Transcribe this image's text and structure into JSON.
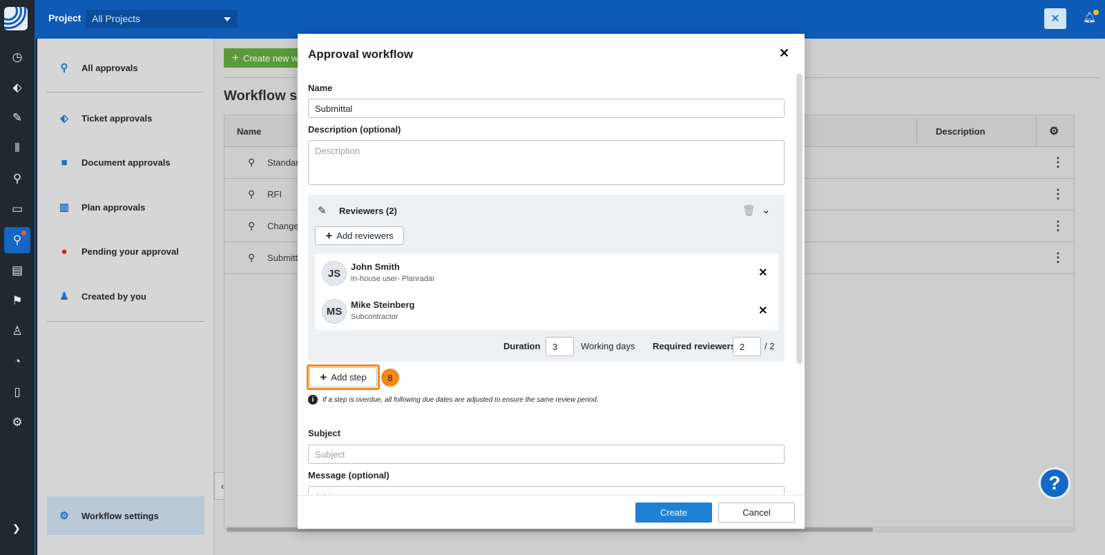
{
  "topbar": {
    "project_label": "Project",
    "project_select_value": "All Projects"
  },
  "sidebar": {
    "items": [
      {
        "label": "All approvals",
        "icon": "stamp-icon"
      },
      {
        "label": "Ticket approvals",
        "icon": "tag-icon"
      },
      {
        "label": "Document approvals",
        "icon": "folder-icon"
      },
      {
        "label": "Plan approvals",
        "icon": "map-icon"
      },
      {
        "label": "Pending your approval",
        "icon": "clock-icon"
      },
      {
        "label": "Created by you",
        "icon": "person-icon"
      }
    ],
    "settings_label": "Workflow settings"
  },
  "main": {
    "create_button": "Create new w",
    "title": "Workflow se",
    "table": {
      "col_name": "Name",
      "col_description": "Description",
      "rows": [
        {
          "name": "Standar"
        },
        {
          "name": "RFI"
        },
        {
          "name": "Change"
        },
        {
          "name": "Submitt"
        }
      ]
    }
  },
  "modal": {
    "title": "Approval workflow",
    "name_label": "Name",
    "name_value": "Submittal",
    "description_label": "Description (optional)",
    "description_placeholder": "Description",
    "reviewers_title": "Reviewers (2)",
    "add_reviewers_label": "Add reviewers",
    "reviewers": [
      {
        "initials": "JS",
        "name": "John Smith",
        "role": "In-house user- Planradar"
      },
      {
        "initials": "MS",
        "name": "Mike Steinberg",
        "role": "Subcontractor"
      }
    ],
    "duration_label": "Duration",
    "duration_value": "3",
    "working_days_label": "Working days",
    "required_reviewers_label": "Required reviewers",
    "required_reviewers_value": "2",
    "required_reviewers_total": "/ 2",
    "add_step_label": "Add step",
    "step_badge": "8",
    "info_text": "If a step is overdue, all following due dates are adjusted to ensure the same review period.",
    "subject_label": "Subject",
    "subject_placeholder": "Subject",
    "message_label": "Message (optional)",
    "message_placeholder": "Add message",
    "create_label": "Create",
    "cancel_label": "Cancel"
  },
  "colors": {
    "brand_blue": "#0d5bb7",
    "primary_button": "#1e80d6",
    "highlight_orange": "#f08a13",
    "create_green": "#5b9a3a"
  }
}
